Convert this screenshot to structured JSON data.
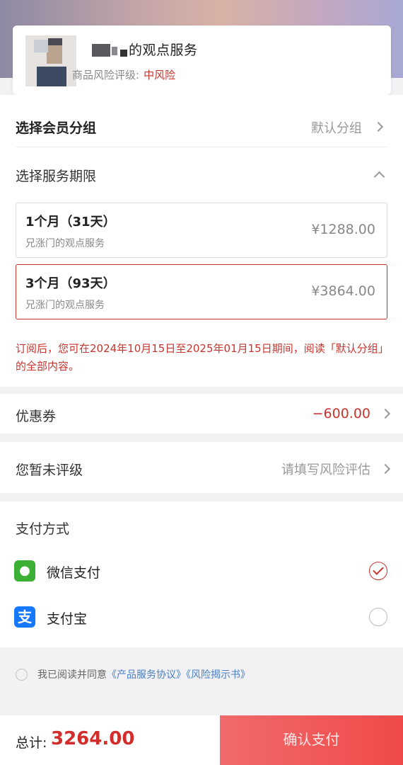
{
  "header": {
    "service_name": "的观点服务",
    "risk_label": "商品风险评级:",
    "risk_value": "中风险"
  },
  "member_group": {
    "label": "选择会员分组",
    "value": "默认分组"
  },
  "service_period": {
    "label": "选择服务期限",
    "plans": [
      {
        "name": "1个月（31天）",
        "desc": "兄涨门的观点服务",
        "price": "¥1288.00",
        "selected": false
      },
      {
        "name": "3个月（93天）",
        "desc": "兄涨门的观点服务",
        "price": "¥3864.00",
        "selected": true
      }
    ],
    "notice": "订阅后，您可在2024年10月15日至2025年01月15日期间，阅读「默认分组」的全部内容。"
  },
  "coupon": {
    "label": "优惠券",
    "value": "−600.00"
  },
  "rating": {
    "label": "您暂未评级",
    "action": "请填写风险评估"
  },
  "payment": {
    "title": "支付方式",
    "methods": [
      {
        "label": "微信支付",
        "icon": "wechat-icon",
        "selected": true
      },
      {
        "label": "支付宝",
        "icon": "alipay-icon",
        "selected": false
      }
    ]
  },
  "agreement": {
    "prefix": "我已阅读并同意",
    "link1": "《产品服务协议》",
    "link2": "《风险揭示书》"
  },
  "footer": {
    "total_label": "总计:",
    "total_value": "3264.00",
    "confirm_label": "确认支付"
  },
  "colors": {
    "accent_red": "#c8342e",
    "button_red": "#ef4a4a",
    "link_blue": "#4a7fc2",
    "wechat_green": "#3cb034",
    "alipay_blue": "#1677ff"
  }
}
